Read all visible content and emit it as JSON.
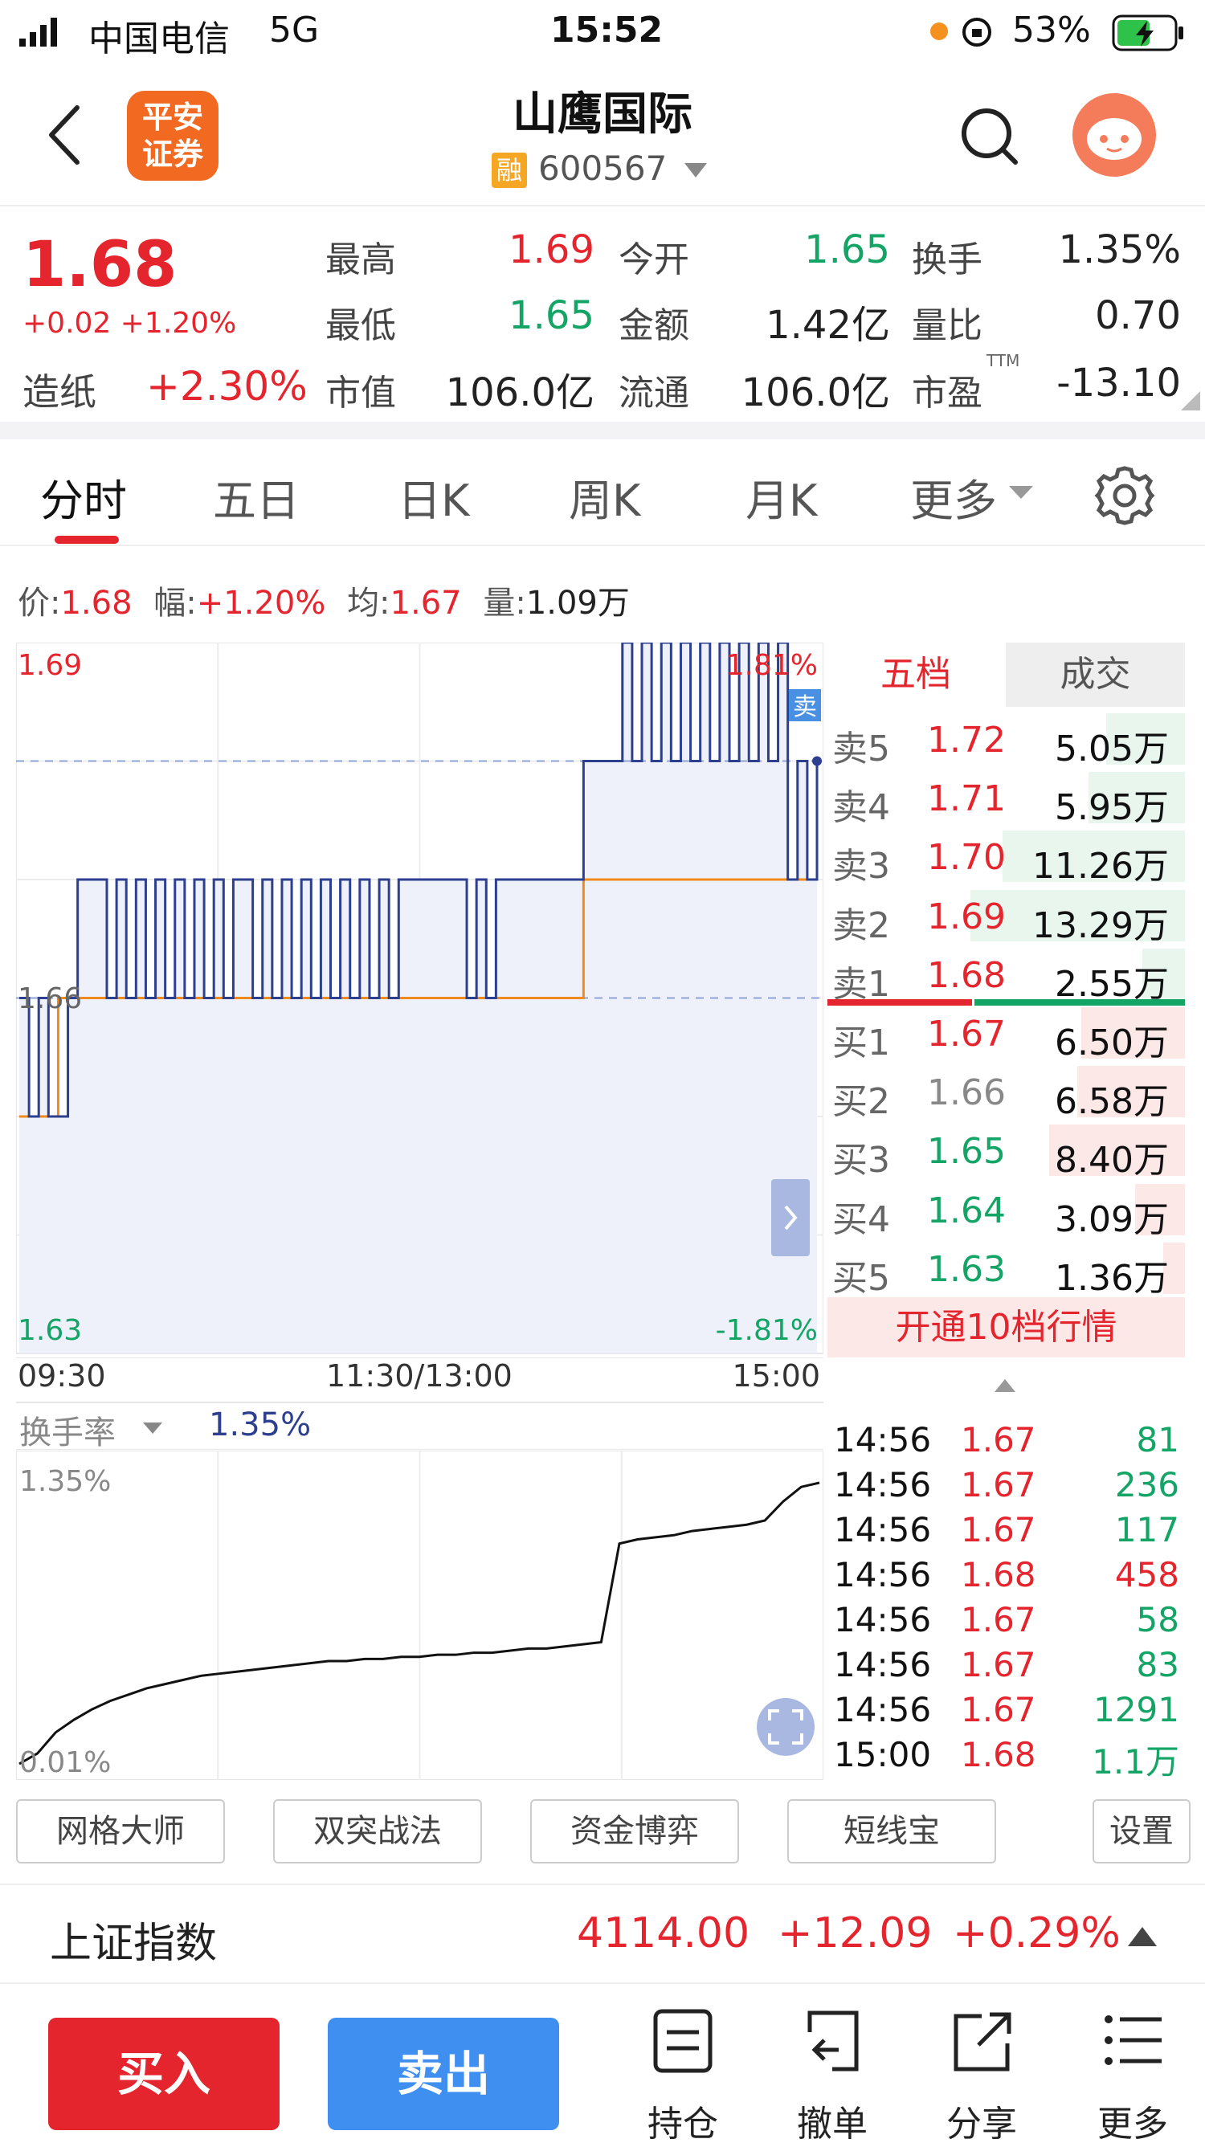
{
  "status_bar": {
    "carrier": "中国电信",
    "network": "5G",
    "time": "15:52",
    "battery": "53%"
  },
  "nav": {
    "logo_line1": "平安",
    "logo_line2": "证券",
    "stock_name": "山鹰国际",
    "badge": "融",
    "code": "600567",
    "icons": [
      "back-icon",
      "search-icon",
      "assistant-avatar-icon"
    ]
  },
  "quote": {
    "price": "1.68",
    "change": "+0.02 +1.20%",
    "sector_name": "造纸",
    "sector_change": "+2.30%",
    "fields": {
      "high_label": "最高",
      "high": "1.69",
      "low_label": "最低",
      "low": "1.65",
      "mcap_label": "市值",
      "mcap": "106.0亿",
      "open_label": "今开",
      "open": "1.65",
      "amount_label": "金额",
      "amount": "1.42亿",
      "float_label": "流通",
      "float": "106.0亿",
      "turnover_label": "换手",
      "turnover": "1.35%",
      "volratio_label": "量比",
      "volratio": "0.70",
      "pe_label": "市盈",
      "pe_sup": "TTM",
      "pe": "-13.10"
    }
  },
  "tabs": [
    "分时",
    "五日",
    "日K",
    "周K",
    "月K",
    "更多"
  ],
  "info_line": {
    "price_label": "价:",
    "price": "1.68",
    "amp_label": "幅:",
    "amp": "+1.20%",
    "avg_label": "均:",
    "avg": "1.67",
    "vol_label": "量:",
    "vol": "1.09万"
  },
  "chart_labels": {
    "top_left": "1.69",
    "top_right": "1.81%",
    "mid_left": "1.66",
    "bottom_left": "1.63",
    "bottom_right": "-1.81%",
    "sell_tag": "卖",
    "time_start": "09:30",
    "time_mid": "11:30/13:00",
    "time_end": "15:00",
    "indicator": "换手率",
    "indicator_value": "1.35%",
    "ind_top": "1.35%",
    "ind_bottom": "0.01%"
  },
  "chart_data": [
    {
      "type": "line",
      "name": "intraday",
      "x": [
        "09:30",
        "11:30/13:00",
        "15:00"
      ],
      "ylim": [
        1.63,
        1.69
      ],
      "right_axis_pct": [
        "1.81%",
        "-1.81%"
      ],
      "series": [
        {
          "name": "price",
          "color": "#2d3f8f",
          "values": [
            1.66,
            1.65,
            1.66,
            1.65,
            1.65,
            1.66,
            1.67,
            1.67,
            1.67,
            1.66,
            1.67,
            1.66,
            1.67,
            1.66,
            1.67,
            1.66,
            1.67,
            1.66,
            1.67,
            1.66,
            1.67,
            1.66,
            1.67,
            1.67,
            1.66,
            1.67,
            1.66,
            1.67,
            1.66,
            1.67,
            1.66,
            1.67,
            1.66,
            1.67,
            1.66,
            1.67,
            1.66,
            1.67,
            1.66,
            1.67,
            1.67,
            1.67,
            1.67,
            1.67,
            1.67,
            1.67,
            1.66,
            1.67,
            1.66,
            1.67,
            1.67,
            1.67,
            1.67,
            1.67,
            1.67,
            1.67,
            1.67,
            1.67,
            1.68,
            1.68,
            1.68,
            1.68,
            1.69,
            1.68,
            1.69,
            1.68,
            1.69,
            1.68,
            1.69,
            1.68,
            1.69,
            1.68,
            1.69,
            1.68,
            1.69,
            1.68,
            1.69,
            1.68,
            1.69,
            1.67,
            1.68,
            1.67,
            1.68
          ]
        },
        {
          "name": "avg",
          "color": "#f08a1c",
          "values": [
            1.65,
            1.65,
            1.65,
            1.65,
            1.66,
            1.66,
            1.66,
            1.66,
            1.66,
            1.66,
            1.66,
            1.66,
            1.66,
            1.66,
            1.66,
            1.66,
            1.66,
            1.66,
            1.66,
            1.66,
            1.66,
            1.66,
            1.66,
            1.66,
            1.66,
            1.66,
            1.66,
            1.66,
            1.66,
            1.66,
            1.66,
            1.66,
            1.66,
            1.66,
            1.66,
            1.66,
            1.66,
            1.66,
            1.66,
            1.66,
            1.66,
            1.66,
            1.66,
            1.66,
            1.66,
            1.66,
            1.66,
            1.66,
            1.66,
            1.66,
            1.66,
            1.66,
            1.66,
            1.66,
            1.66,
            1.66,
            1.66,
            1.66,
            1.67,
            1.67,
            1.67,
            1.67,
            1.67,
            1.67,
            1.67,
            1.67,
            1.67,
            1.67,
            1.67,
            1.67,
            1.67,
            1.67,
            1.67,
            1.67,
            1.67,
            1.67,
            1.67,
            1.67,
            1.67,
            1.67,
            1.67,
            1.67,
            1.67
          ]
        }
      ],
      "prev_close": 1.66
    },
    {
      "type": "line",
      "name": "turnover",
      "ylim": [
        0.01,
        1.35
      ],
      "series": [
        {
          "name": "换手率",
          "color": "#111111",
          "values": [
            0.01,
            0.06,
            0.16,
            0.22,
            0.27,
            0.31,
            0.34,
            0.37,
            0.39,
            0.41,
            0.43,
            0.44,
            0.45,
            0.46,
            0.47,
            0.48,
            0.49,
            0.5,
            0.5,
            0.51,
            0.51,
            0.52,
            0.52,
            0.53,
            0.53,
            0.54,
            0.54,
            0.55,
            0.56,
            0.56,
            0.57,
            0.58,
            0.59,
            1.06,
            1.08,
            1.09,
            1.1,
            1.12,
            1.13,
            1.14,
            1.15,
            1.17,
            1.26,
            1.33,
            1.35
          ]
        }
      ]
    }
  ],
  "order_book": {
    "tab_active": "五档",
    "tab_other": "成交",
    "asks": [
      {
        "label": "卖5",
        "price": "1.72",
        "vol": "5.05万",
        "fill": 0.22
      },
      {
        "label": "卖4",
        "price": "1.71",
        "vol": "5.95万",
        "fill": 0.27
      },
      {
        "label": "卖3",
        "price": "1.70",
        "vol": "11.26万",
        "fill": 0.51
      },
      {
        "label": "卖2",
        "price": "1.69",
        "vol": "13.29万",
        "fill": 0.6
      },
      {
        "label": "卖1",
        "price": "1.68",
        "vol": "2.55万",
        "fill": 0.12
      }
    ],
    "bids": [
      {
        "label": "买1",
        "price": "1.67",
        "vol": "6.50万",
        "fill": 0.29
      },
      {
        "label": "买2",
        "price": "1.66",
        "vol": "6.58万",
        "fill": 0.3
      },
      {
        "label": "买3",
        "price": "1.65",
        "vol": "8.40万",
        "fill": 0.38
      },
      {
        "label": "买4",
        "price": "1.64",
        "vol": "3.09万",
        "fill": 0.14
      },
      {
        "label": "买5",
        "price": "1.63",
        "vol": "1.36万",
        "fill": 0.06
      }
    ],
    "upgrade": "开通10档行情"
  },
  "trades": [
    {
      "time": "14:56",
      "price": "1.67",
      "vol": "81",
      "side": "green"
    },
    {
      "time": "14:56",
      "price": "1.67",
      "vol": "236",
      "side": "green"
    },
    {
      "time": "14:56",
      "price": "1.67",
      "vol": "117",
      "side": "green"
    },
    {
      "time": "14:56",
      "price": "1.68",
      "vol": "458",
      "side": "red"
    },
    {
      "time": "14:56",
      "price": "1.67",
      "vol": "58",
      "side": "green"
    },
    {
      "time": "14:56",
      "price": "1.67",
      "vol": "83",
      "side": "green"
    },
    {
      "time": "14:56",
      "price": "1.67",
      "vol": "1291",
      "side": "green"
    },
    {
      "time": "15:00",
      "price": "1.68",
      "vol": "1.1万",
      "side": "green"
    }
  ],
  "strategies": [
    "网格大师",
    "双突战法",
    "资金博弈",
    "短线宝",
    "设置"
  ],
  "index_bar": {
    "name": "上证指数",
    "value": "4114.00",
    "change": "+12.09",
    "pct": "+0.29%"
  },
  "toolbar": {
    "buy": "买入",
    "sell": "卖出",
    "hold": "持仓",
    "cancel": "撤单",
    "share": "分享",
    "more": "更多"
  },
  "colors": {
    "red": "#e5252d",
    "green": "#13a466",
    "blue_btn": "#3f8ff0",
    "price_line": "#2d3f8f",
    "avg_line": "#f08a1c"
  }
}
